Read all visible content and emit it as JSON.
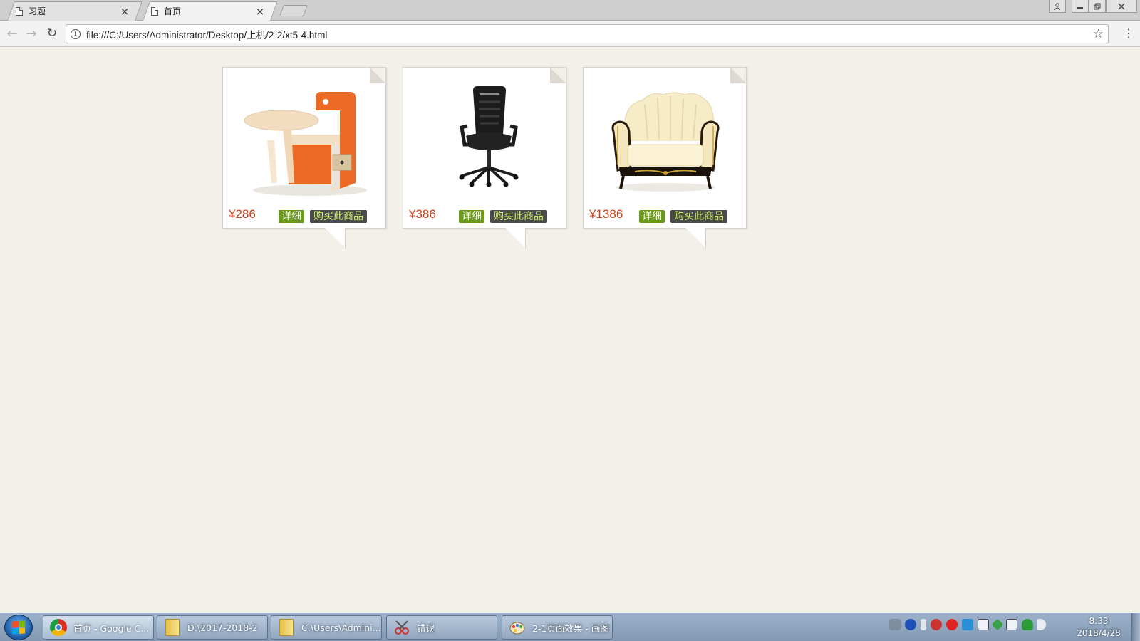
{
  "browser": {
    "tabs": [
      {
        "title": "习题",
        "active": false
      },
      {
        "title": "首页",
        "active": true
      }
    ],
    "url": "file:///C:/Users/Administrator/Desktop/上机/2-2/xt5-4.html"
  },
  "products": [
    {
      "name": "kids desk chair",
      "price": "¥286",
      "detail_label": "详细",
      "buy_label": "购买此商品"
    },
    {
      "name": "office chair",
      "price": "¥386",
      "detail_label": "详细",
      "buy_label": "购买此商品"
    },
    {
      "name": "armchair sofa",
      "price": "¥1386",
      "detail_label": "详细",
      "buy_label": "购买此商品"
    }
  ],
  "taskbar": {
    "items": [
      {
        "label": "首页 - Google C...",
        "icon": "chrome-icon"
      },
      {
        "label": "D:\\2017-2018-2",
        "icon": "folder-icon"
      },
      {
        "label": "C:\\Users\\Admini...",
        "icon": "folder-icon"
      },
      {
        "label": "错误",
        "icon": "snipping-tool-icon"
      },
      {
        "label": "2-1页面效果 - 画图",
        "icon": "paint-icon"
      }
    ],
    "clock_time": "8:33",
    "clock_date": "2018/4/28"
  },
  "colors": {
    "page_background": "#f3f0ea",
    "price": "#c9411b",
    "detail_button": "#6a9a1a",
    "buy_button": "#4a4a4a",
    "buy_button_text": "#d4f56a"
  }
}
